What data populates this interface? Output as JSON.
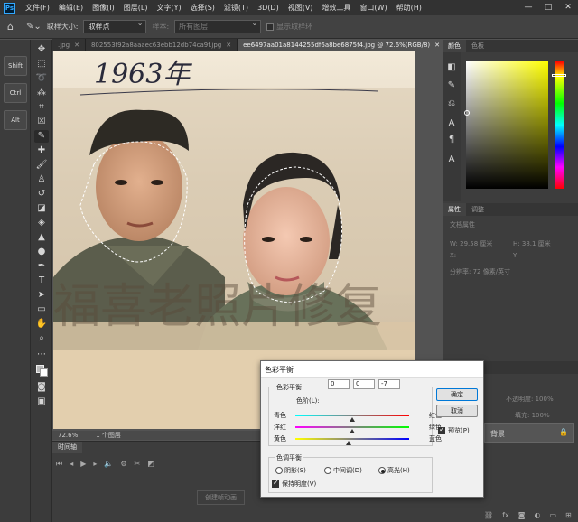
{
  "app": {
    "logo": "Ps"
  },
  "menu": [
    "文件(F)",
    "编辑(E)",
    "图像(I)",
    "图层(L)",
    "文字(Y)",
    "选择(S)",
    "滤镜(T)",
    "3D(D)",
    "视图(V)",
    "增效工具",
    "窗口(W)",
    "帮助(H)"
  ],
  "window_controls": [
    "—",
    "□",
    "✕"
  ],
  "options_bar": {
    "sample_size_label": "取样大小:",
    "sample_size_value": "取样点",
    "sample_label": "样本:",
    "sample_value": "所有图层",
    "show_ring_label": "显示取样环"
  },
  "left_keys": [
    "Shift",
    "Ctrl",
    "Alt"
  ],
  "tabs": [
    {
      "label": ".jpg",
      "active": false
    },
    {
      "label": "802553f92a8aaaec63ebb12db74ca9f.jpg",
      "active": false
    },
    {
      "label": "ee6497aa01a8144255df6a8be6875f4.jpg @ 72.6%(RGB/8)",
      "active": true
    }
  ],
  "photo": {
    "year_text": "1963年",
    "watermark": "福喜老照片修复"
  },
  "status": {
    "zoom": "72.6%",
    "layers": "1 个图层"
  },
  "timeline": {
    "tab": "时间轴",
    "create_button": "创建帧动画"
  },
  "right_panel": {
    "color_tabs": [
      "颜色",
      "色板"
    ],
    "props_tabs": [
      "属性",
      "调整"
    ],
    "props_title": "文档属性",
    "w_label": "W:",
    "w_value": "29.58 厘米",
    "h_label": "H:",
    "h_value": "38.1 厘米",
    "x_label": "X:",
    "y_label": "Y:",
    "resolution": "分辨率: 72 像素/英寸",
    "layers_tabs": [
      "图层",
      "路径"
    ],
    "opacity_label": "不透明度:",
    "opacity_value": "100%",
    "fill_label": "填充:",
    "fill_value": "100%",
    "layer_name": "背景"
  },
  "dialog": {
    "title": "色彩平衡",
    "balance_group": "色彩平衡",
    "levels_label": "色阶(L):",
    "levels": [
      "0",
      "0",
      "-7"
    ],
    "sliders": [
      {
        "left": "青色",
        "right": "红色",
        "value": 0
      },
      {
        "left": "洋红",
        "right": "绿色",
        "value": 0
      },
      {
        "left": "黄色",
        "right": "蓝色",
        "value": -7
      }
    ],
    "tone_group": "色调平衡",
    "tones": [
      {
        "label": "阴影(S)",
        "checked": false
      },
      {
        "label": "中间调(D)",
        "checked": false
      },
      {
        "label": "高光(H)",
        "checked": true
      }
    ],
    "preserve_label": "保持明度(V)",
    "ok": "确定",
    "cancel": "取消",
    "preview": "预览(P)"
  },
  "colors": {
    "accent": "#0078d7",
    "ps_blue": "#31a8ff"
  }
}
